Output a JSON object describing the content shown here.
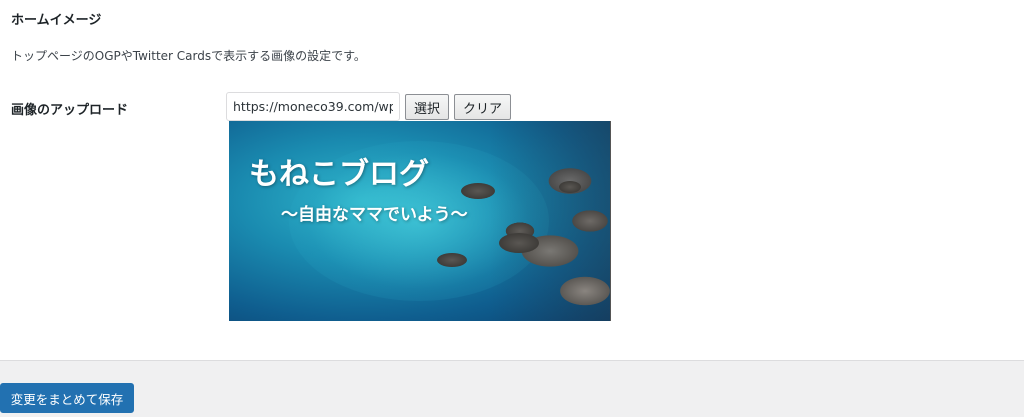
{
  "section": {
    "title": "ホームイメージ",
    "description": "トップページのOGPやTwitter Cardsで表示する画像の設定です。"
  },
  "upload": {
    "label": "画像のアップロード",
    "url_value": "https://moneco39.com/wp",
    "select_label": "選択",
    "clear_label": "クリア"
  },
  "preview": {
    "title": "もねこブログ",
    "subtitle": "〜自由なママでいよう〜"
  },
  "footer": {
    "save_label": "変更をまとめて保存"
  },
  "colors": {
    "primary_button": "#2271b1",
    "footer_background": "#f0f0f1"
  }
}
